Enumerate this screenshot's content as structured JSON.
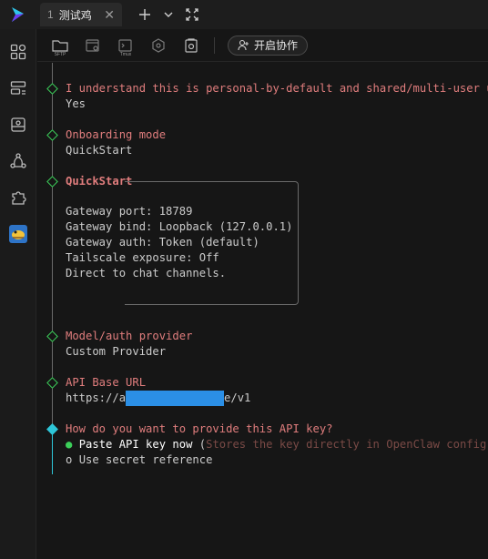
{
  "tab": {
    "number": "1",
    "title": "测试鸡"
  },
  "toolbar": {
    "sftp_label": "SFTP",
    "tmux_label": "Tmux",
    "collab_label": "开启协作"
  },
  "terminal": {
    "security_question": "I understand this is personal-by-default and shared/multi-user use",
    "security_answer": "Yes",
    "onboarding_label": "Onboarding mode",
    "onboarding_value": "QuickStart",
    "quickstart_title": "QuickStart",
    "quickstart_lines": [
      "Gateway port: 18789",
      "Gateway bind: Loopback (127.0.0.1)",
      "Gateway auth: Token (default)",
      "Tailscale exposure: Off",
      "Direct to chat channels."
    ],
    "provider_label": "Model/auth provider",
    "provider_value": "Custom Provider",
    "api_url_label": "API Base URL",
    "api_url_prefix": "https://a",
    "api_url_suffix": "e/v1",
    "api_key_question": "How do you want to provide this API key?",
    "option_selected_bullet": "●",
    "option_selected_label": "Paste API key now",
    "option_selected_hint_open": " (",
    "option_selected_hint": "Stores the key directly in OpenClaw config",
    "option_selected_hint_close": ")",
    "option_other_bullet": "o",
    "option_other_label": "Use secret reference"
  }
}
